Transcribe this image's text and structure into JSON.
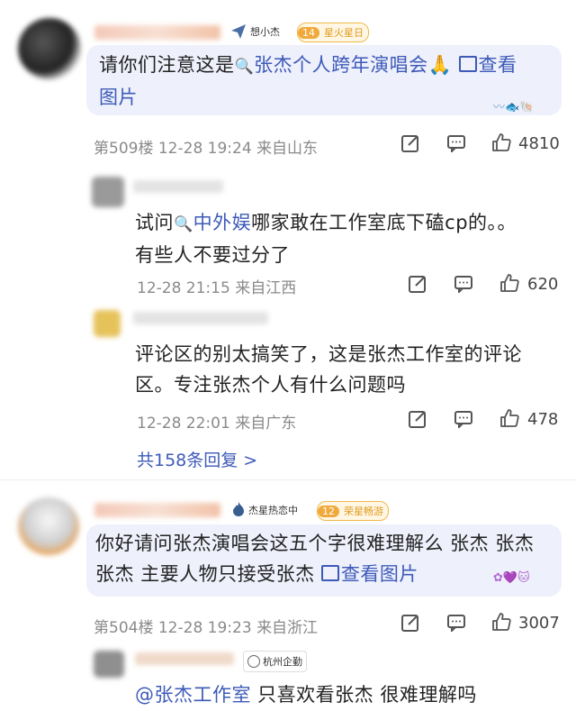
{
  "comments": [
    {
      "badge": "想小杰",
      "level_badge": "14",
      "level_text": "星火星日",
      "text_pre": "请你们注意这是",
      "link": "张杰个人跨年演唱会",
      "emoji": "🙏",
      "view_pic": "查看",
      "view_pic_2": "图片",
      "floor": "第509楼",
      "time": "12-28 19:24",
      "location": "来自山东",
      "likes": "4810"
    },
    {
      "text_pre": "试问",
      "link": "中外娱",
      "text_post": "哪家敢在工作室底下磕cp的。。",
      "line2": "有些人不要过分了",
      "time": "12-28 21:15",
      "location": "来自江西",
      "likes": "620"
    },
    {
      "line1": "评论区的别太搞笑了，这是张杰工作室的评论",
      "line2": "区。专注张杰个人有什么问题吗",
      "time": "12-28 22:01",
      "location": "来自广东",
      "likes": "478"
    },
    {
      "badge": "杰星热恋中",
      "level_badge": "12",
      "level_text": "荣星畅游",
      "line1": "你好请问张杰演唱会这五个字很难理解么 张杰 张杰",
      "line2_pre": "张杰 主要人物只接受张杰",
      "view_pic": "查看图片",
      "floor": "第504楼",
      "time": "12-28 19:23",
      "location": "来自浙江",
      "likes": "3007"
    },
    {
      "badge": "杭州企勤",
      "mention": "@张杰工作室",
      "text_post": " 只喜欢看张杰 很难理解吗"
    }
  ],
  "replies_link": "共158条回复 >",
  "colors": {
    "link": "#3d5ab8",
    "bubble": "#eef0fb",
    "meta": "#8a8a8a"
  }
}
